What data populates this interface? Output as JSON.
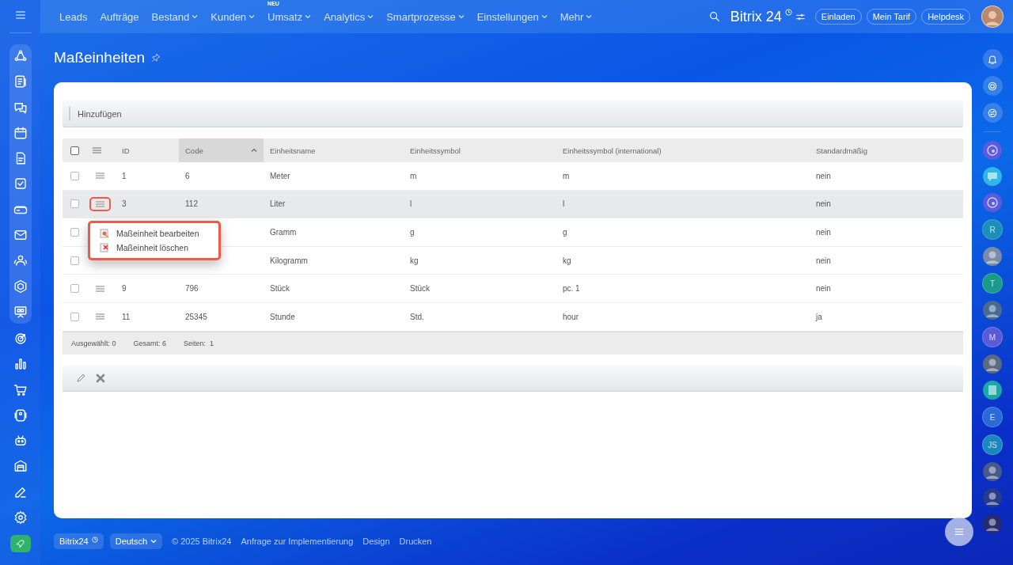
{
  "top_nav": {
    "items": [
      {
        "label": "Leads",
        "dropdown": false
      },
      {
        "label": "Aufträge",
        "dropdown": false
      },
      {
        "label": "Bestand",
        "dropdown": true
      },
      {
        "label": "Kunden",
        "dropdown": true
      },
      {
        "label": "Umsatz",
        "dropdown": true,
        "badge": "NEU"
      },
      {
        "label": "Analytics",
        "dropdown": true
      },
      {
        "label": "Smartprozesse",
        "dropdown": true
      },
      {
        "label": "Einstellungen",
        "dropdown": true
      },
      {
        "label": "Mehr",
        "dropdown": true
      }
    ],
    "brand": "Bitrix",
    "brand_number": "24",
    "buttons": [
      "Einladen",
      "Mein Tarif",
      "Helpdesk"
    ]
  },
  "page": {
    "title": "Maßeinheiten"
  },
  "toolbar": {
    "add_button": "Hinzufügen"
  },
  "table": {
    "header_checkbox": {
      "checked": false
    },
    "columns": [
      {
        "label": "ID",
        "sorted": false
      },
      {
        "label": "Code",
        "sorted": true
      },
      {
        "label": "Einheitsname",
        "sorted": false
      },
      {
        "label": "Einheitssymbol",
        "sorted": false
      },
      {
        "label": "Einheitssymbol (international)",
        "sorted": false
      },
      {
        "label": "Standardmäßig",
        "sorted": false
      }
    ],
    "rows": [
      {
        "cells": [
          "1",
          "6",
          "Meter",
          "m",
          "m",
          "nein"
        ],
        "checked": false,
        "highlighted": false,
        "menu_open": false
      },
      {
        "cells": [
          "3",
          "112",
          "Liter",
          "l",
          "l",
          "nein"
        ],
        "checked": false,
        "highlighted": true,
        "menu_open": true
      },
      {
        "cells": [
          "",
          "",
          "Gramm",
          "g",
          "g",
          "nein"
        ],
        "checked": false,
        "highlighted": false,
        "menu_open": false
      },
      {
        "cells": [
          "",
          "",
          "Kilogramm",
          "kg",
          "kg",
          "nein"
        ],
        "checked": false,
        "highlighted": false,
        "menu_open": false
      },
      {
        "cells": [
          "9",
          "796",
          "Stück",
          "Stück",
          "pc. 1",
          "nein"
        ],
        "checked": false,
        "highlighted": false,
        "menu_open": false
      },
      {
        "cells": [
          "11",
          "25345",
          "Stunde",
          "Std.",
          "hour",
          "ja"
        ],
        "checked": false,
        "highlighted": false,
        "menu_open": false
      }
    ]
  },
  "context_menu": {
    "items": [
      {
        "label": "Maßeinheit bearbeiten",
        "kind": "edit"
      },
      {
        "label": "Maßeinheit löschen",
        "kind": "delete"
      }
    ]
  },
  "table_footer": {
    "selected": "Ausgewählt: 0",
    "total": "Gesamt: 6",
    "pages_label": "Seiten:",
    "pages": "1"
  },
  "footer": {
    "brand": "Bitrix24",
    "language": "Deutsch",
    "copyright": "© 2025 Bitrix24",
    "links": [
      "Anfrage zur Implementierung",
      "Design",
      "Drucken"
    ]
  },
  "contacts": [
    {
      "kind": "channel",
      "color": "#5b5be0"
    },
    {
      "kind": "chat",
      "color": "#2fb6e8"
    },
    {
      "kind": "channel",
      "color": "#5b5be0"
    },
    {
      "kind": "initials",
      "initials": "R",
      "color": "#1a8fb8"
    },
    {
      "kind": "photo",
      "color": "#7a8aa8"
    },
    {
      "kind": "initials",
      "initials": "T",
      "color": "#1a9a8a"
    },
    {
      "kind": "photo",
      "color": "#4a6a90"
    },
    {
      "kind": "initials",
      "initials": "M",
      "color": "#5a5ad8"
    },
    {
      "kind": "photo",
      "color": "#5a6a80"
    },
    {
      "kind": "document",
      "color": "#1aa8a8"
    },
    {
      "kind": "initials",
      "initials": "E",
      "color": "#2a6ad8"
    },
    {
      "kind": "initials",
      "initials": "JS",
      "color": "#1a88c0"
    },
    {
      "kind": "photo",
      "color": "#4a5a88"
    },
    {
      "kind": "photo",
      "color": "#2a3a8a"
    },
    {
      "kind": "photo",
      "color": "#2a2a70"
    }
  ]
}
